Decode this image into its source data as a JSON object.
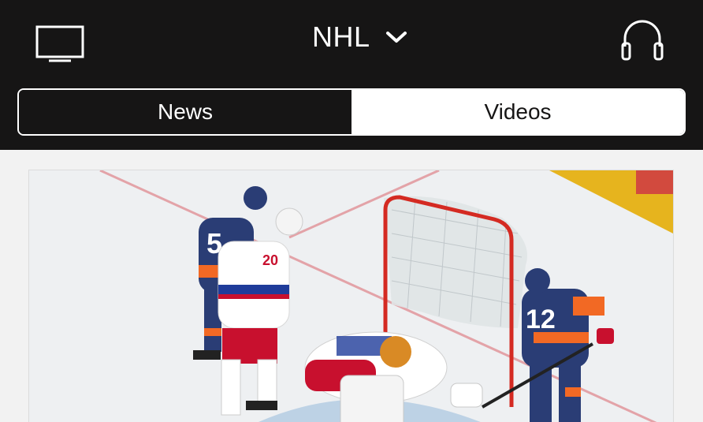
{
  "header": {
    "league": "NHL",
    "tv_icon": "tv-icon",
    "dropdown_icon": "chevron-down-icon",
    "audio_icon": "headphones-icon"
  },
  "tabs": [
    {
      "label": "News",
      "active": true
    },
    {
      "label": "Videos",
      "active": false
    }
  ],
  "feed": {
    "image_description_icon": "hockey-photo"
  },
  "colors": {
    "header_bg": "#161515",
    "content_bg": "#f2f2f2",
    "rangers_white": "#ffffff",
    "rangers_blue": "#1f3c9a",
    "rangers_red": "#c8102e",
    "islanders_navy": "#2a3d75",
    "islanders_orange": "#f26924"
  }
}
